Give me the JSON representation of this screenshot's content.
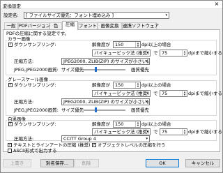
{
  "window": {
    "title": "変換設定",
    "close_glyph": "×"
  },
  "preset": {
    "label": "設定名:",
    "value": "[ ファイルサイズ優先：フォント埋め込み ]"
  },
  "tabs": [
    "一般",
    "PDFバージョン",
    "色",
    "圧縮",
    "フォント",
    "画像変換",
    "連携ソフトウェア"
  ],
  "active_tab": "圧縮",
  "panel": {
    "heading": "PDFの圧縮に関する設定です。",
    "color": {
      "legend": "カラー画像",
      "downsample_label": "ダウンサンプリング:",
      "downsample_checked": true,
      "resolution_label": "解像度が",
      "resolution_value": "150",
      "dpi_above": "dpi以上の場合",
      "method": "バイキュービック法 (推奨)",
      "de": "で",
      "dpi_target_value": "75",
      "dpi_target_suffix": "dpiまで縮小する。",
      "compression_label": "圧縮方法:",
      "compression_value": "JPEG2000, ZLIB(ZIP) のサイズが小さいほう",
      "jpeg_label": "JPEG,JPEG2000画質:",
      "size_priority": "サイズ優先",
      "quality_priority": "画質優先",
      "slider_level": 0.28
    },
    "gray": {
      "legend": "グレースケール画像",
      "downsample_label": "ダウンサンプリング:",
      "downsample_checked": true,
      "resolution_label": "解像度が",
      "resolution_value": "150",
      "dpi_above": "dpi以上の場合",
      "method": "バイキュービック法 (推奨)",
      "de": "で",
      "dpi_target_value": "75",
      "dpi_target_suffix": "dpiまで縮小する。",
      "compression_label": "圧縮方法:",
      "compression_value": "JPEG2000, ZLIB(ZIP) のサイズが小さいほう",
      "jpeg_label": "JPEG,JPEG2000画質:",
      "size_priority": "サイズ優先",
      "quality_priority": "画質優先",
      "slider_level": 0.28
    },
    "mono": {
      "legend": "白黒画像",
      "downsample_label": "ダウンサンプリング:",
      "downsample_checked": true,
      "resolution_label": "解像度が",
      "resolution_value": "150",
      "dpi_above": "dpi以上の場合",
      "method": "バイキュービック法 (推奨)",
      "de": "で",
      "dpi_target_value": "75",
      "dpi_target_suffix": "dpiまで縮小する。",
      "compression_label": "圧縮方法:",
      "compression_value": "CCITT Group 4"
    },
    "options": {
      "text_lineart": "テキストとラインアートの圧縮 (推奨)",
      "object_level": "オブジェクトレベルの圧縮を行う",
      "ascii": "ASCII形式で出力する",
      "text_lineart_checked": true,
      "object_level_checked": true,
      "ascii_checked": false
    }
  },
  "buttons": {
    "overwrite": "上書き",
    "save_as": "別名保存...",
    "delete": "削除",
    "ok": "OK",
    "cancel": "キャンセル"
  },
  "icons": {
    "check": "✓",
    "dropdown": "▾",
    "spin_up": "▲",
    "spin_down": "▼"
  }
}
